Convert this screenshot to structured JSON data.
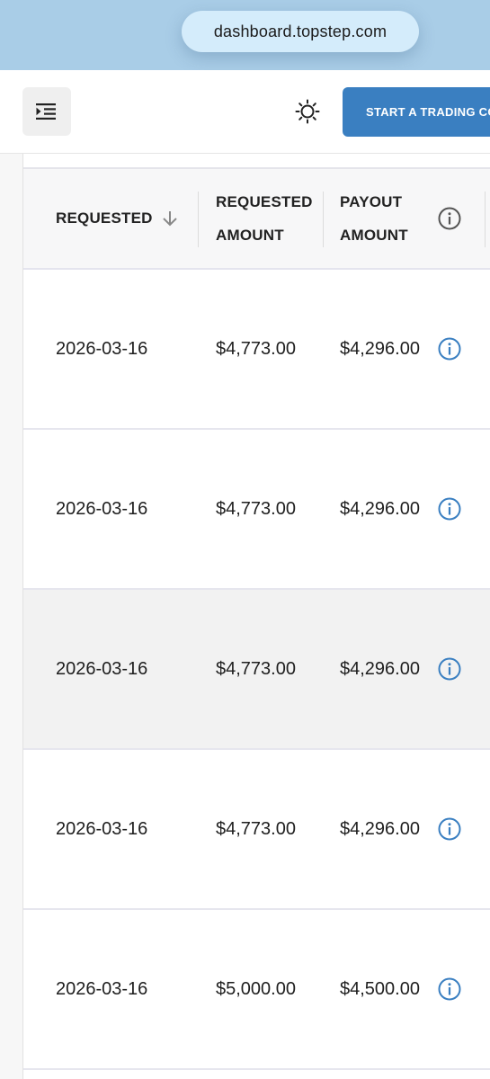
{
  "browser": {
    "url": "dashboard.topstep.com"
  },
  "header": {
    "menu_icon": "menu-indent-icon",
    "theme_icon": "sun-icon",
    "start_button_label": "START A TRADING COMBINE"
  },
  "table": {
    "columns": {
      "requested": "REQUESTED",
      "requested_amount_line1": "REQUESTED",
      "requested_amount_line2": "AMOUNT",
      "payout_amount_line1": "PAYOUT",
      "payout_amount_line2": "AMOUNT"
    },
    "sort_icon": "arrow-down-icon",
    "info_icon": "info-icon",
    "rows": [
      {
        "requested": "2026-03-16",
        "requested_amount": "$4,773.00",
        "payout_amount": "$4,296.00"
      },
      {
        "requested": "2026-03-16",
        "requested_amount": "$4,773.00",
        "payout_amount": "$4,296.00"
      },
      {
        "requested": "2026-03-16",
        "requested_amount": "$4,773.00",
        "payout_amount": "$4,296.00"
      },
      {
        "requested": "2026-03-16",
        "requested_amount": "$4,773.00",
        "payout_amount": "$4,296.00"
      },
      {
        "requested": "2026-03-16",
        "requested_amount": "$5,000.00",
        "payout_amount": "$4,500.00"
      }
    ]
  },
  "colors": {
    "url_bar_bg": "#a9cde7",
    "primary_button": "#3a7fc1",
    "info_icon_blue": "#3a7fc1",
    "header_info_icon": "#555555"
  }
}
